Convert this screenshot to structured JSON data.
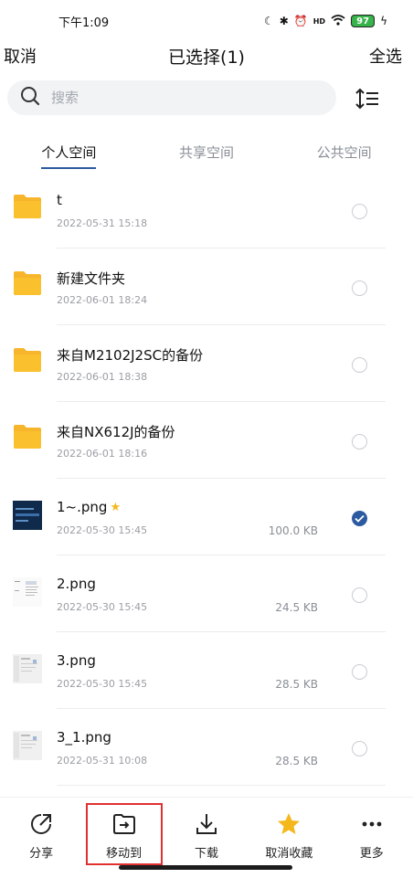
{
  "status_bar": {
    "time": "下午1:09",
    "battery": "97",
    "hd_label": "HD"
  },
  "header": {
    "cancel_label": "取消",
    "title": "已选择(1)",
    "select_all_label": "全选"
  },
  "search": {
    "placeholder": "搜索",
    "value": ""
  },
  "tabs": [
    {
      "label": "个人空间",
      "active": true
    },
    {
      "label": "共享空间",
      "active": false
    },
    {
      "label": "公共空间",
      "active": false
    }
  ],
  "files": [
    {
      "name": "t",
      "date": "2022-05-31 15:18",
      "size": "",
      "type": "folder",
      "checked": false,
      "starred": false
    },
    {
      "name": "新建文件夹",
      "date": "2022-06-01 18:24",
      "size": "",
      "type": "folder",
      "checked": false,
      "starred": false
    },
    {
      "name": "来自M2102J2SC的备份",
      "date": "2022-06-01 18:38",
      "size": "",
      "type": "folder",
      "checked": false,
      "starred": false
    },
    {
      "name": "来自NX612J的备份",
      "date": "2022-06-01 18:16",
      "size": "",
      "type": "folder",
      "checked": false,
      "starred": false
    },
    {
      "name": "1~.png",
      "date": "2022-05-30 15:45",
      "size": "100.0 KB",
      "type": "image",
      "checked": true,
      "starred": true
    },
    {
      "name": "2.png",
      "date": "2022-05-30 15:45",
      "size": "24.5 KB",
      "type": "image",
      "checked": false,
      "starred": false
    },
    {
      "name": "3.png",
      "date": "2022-05-30 15:45",
      "size": "28.5 KB",
      "type": "image",
      "checked": false,
      "starred": false
    },
    {
      "name": "3_1.png",
      "date": "2022-05-31 10:08",
      "size": "28.5 KB",
      "type": "image",
      "checked": false,
      "starred": false
    }
  ],
  "bottom_bar": {
    "share_label": "分享",
    "move_label": "移动到",
    "download_label": "下载",
    "unfavorite_label": "取消收藏",
    "more_label": "更多"
  },
  "colors": {
    "accent": "#2c5aa0",
    "folder": "#f7b52c",
    "star": "#f5b81c",
    "highlight": "#e03131"
  }
}
